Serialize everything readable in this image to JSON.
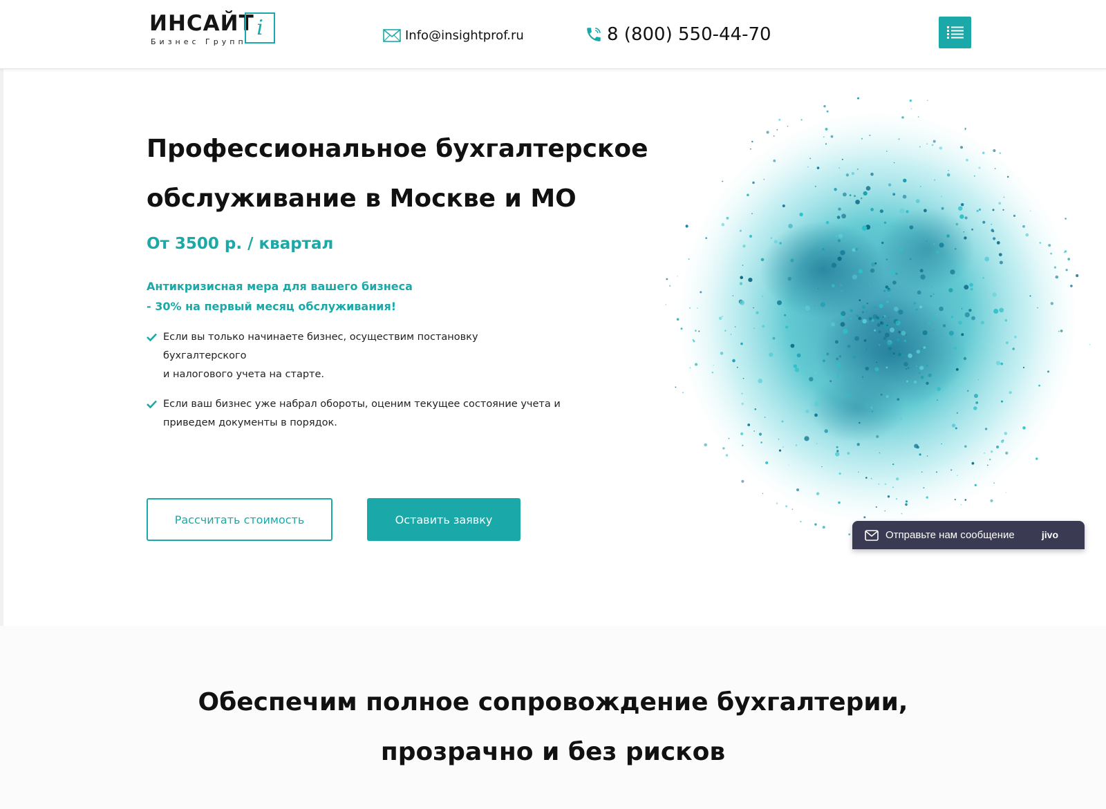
{
  "header": {
    "logo_word": "ИНСАЙТ",
    "logo_sub": "Бизнес Групп",
    "logo_letter": "i",
    "email": "Info@insightprof.ru",
    "phone": "8 (800) 550-44-70"
  },
  "hero": {
    "title_line1": "Профессиональное бухгалтерское",
    "title_line2": "обслуживание в Москве и МО",
    "price": "От 3500 р. / квартал",
    "promo_line1": "Антикризисная мера для вашего бизнеса",
    "promo_line2": "- 30% на первый месяц обслуживания!",
    "bullets": [
      {
        "line1": "Если вы только начинаете бизнес, осуществим постановку бухгалтерского",
        "line2": "и налогового учета на старте."
      },
      {
        "line1": "Если ваш бизнес уже набрал обороты, оценим текущее состояние учета и",
        "line2": "приведем документы в порядок."
      }
    ],
    "btn_calculate": "Рассчитать стоимость",
    "btn_request": "Оставить заявку"
  },
  "chat_widget": {
    "text": "Отправьте нам сообщение",
    "brand": "jivo"
  },
  "section2": {
    "title_line1": "Обеспечим полное сопровождение бухгалтерии,",
    "title_line2": "прозрачно и без рисков"
  },
  "colors": {
    "accent": "#1aa9a8",
    "widget_bg": "#3a3a53",
    "splash_dark": "#1f8aa8",
    "splash_light": "#5fd3dc"
  },
  "icons": [
    "mail-icon",
    "phone-icon",
    "menu-list-icon",
    "check-icon",
    "chat-envelope-icon"
  ]
}
